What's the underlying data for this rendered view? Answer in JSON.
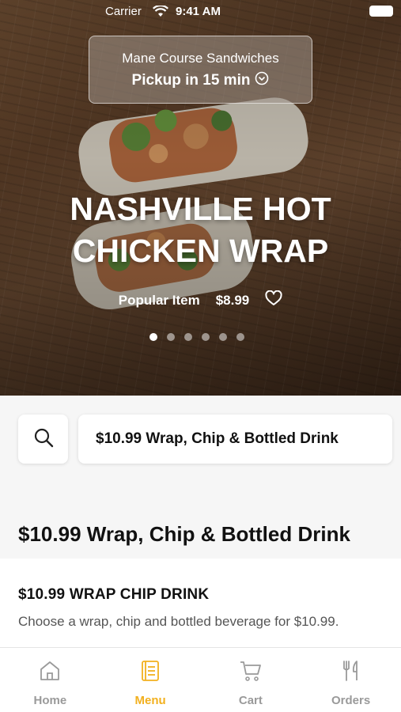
{
  "status_bar": {
    "carrier": "Carrier",
    "time": "9:41 AM"
  },
  "pickup": {
    "restaurant": "Mane Course Sandwiches",
    "time_label": "Pickup in 15 min"
  },
  "featured": {
    "title_line1": "NASHVILLE HOT",
    "title_line2": "CHICKEN WRAP",
    "badge": "Popular Item",
    "price": "$8.99",
    "slide_count": 6,
    "active_slide": 1
  },
  "category_bar": {
    "selected_category": "$10.99 Wrap, Chip & Bottled Drink"
  },
  "section": {
    "heading": "$10.99 Wrap, Chip & Bottled Drink"
  },
  "menu_items": [
    {
      "name": "$10.99 WRAP CHIP DRINK",
      "description": "Choose a wrap, chip and bottled beverage for $10.99."
    }
  ],
  "tabs": [
    {
      "label": "Home",
      "icon": "home-icon",
      "active": false
    },
    {
      "label": "Menu",
      "icon": "menu-book-icon",
      "active": true
    },
    {
      "label": "Cart",
      "icon": "cart-icon",
      "active": false
    },
    {
      "label": "Orders",
      "icon": "fork-knife-icon",
      "active": false
    }
  ],
  "colors": {
    "accent": "#f2b01e",
    "inactive_tab": "#9a9a9a"
  }
}
